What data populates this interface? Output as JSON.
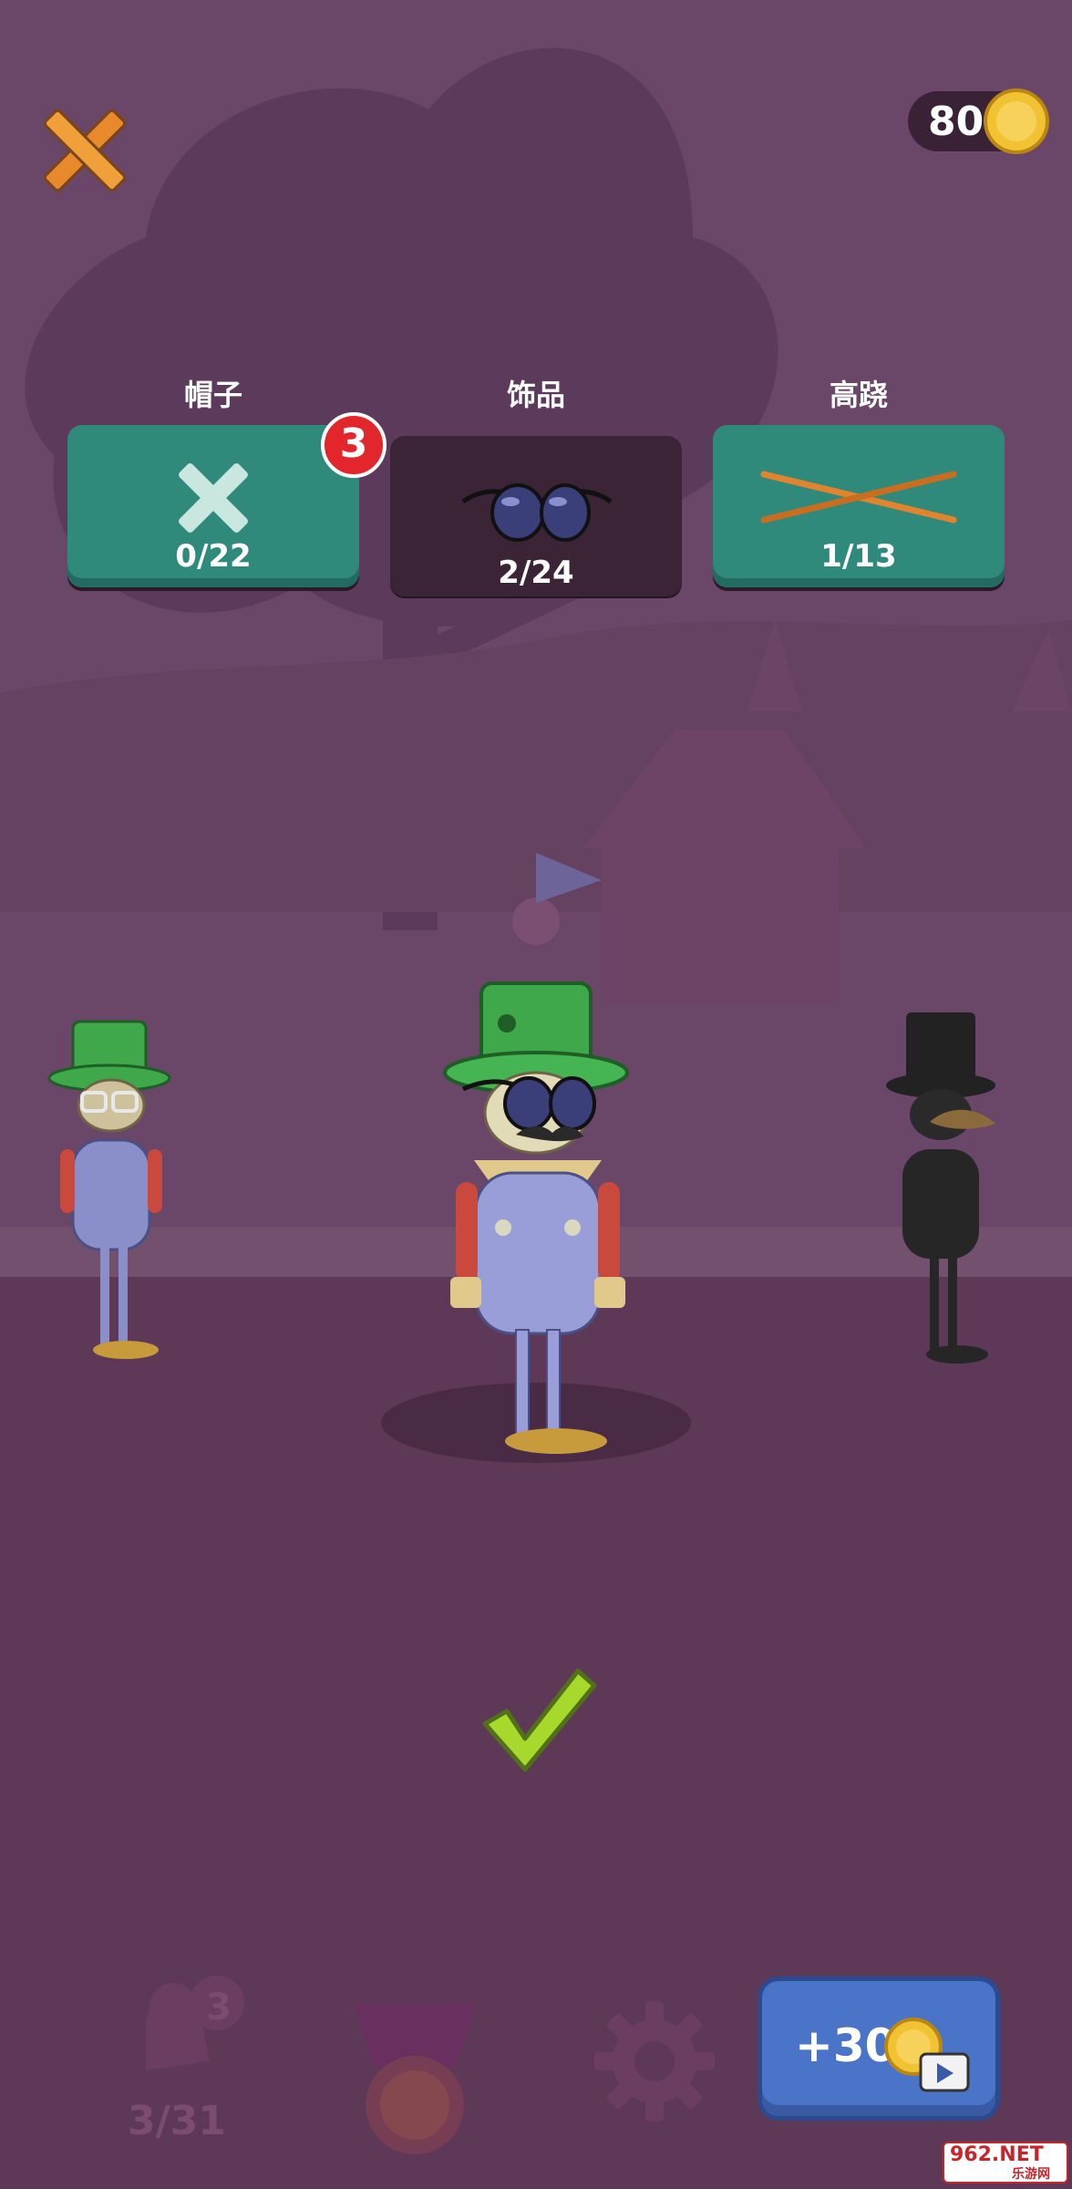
{
  "header": {
    "coins": "80"
  },
  "categories": [
    {
      "label": "帽子",
      "count": "0/22",
      "badge": "3",
      "icon": "x-none-icon"
    },
    {
      "label": "饰品",
      "count": "2/24",
      "icon": "sunglasses-icon"
    },
    {
      "label": "高跷",
      "count": "1/13",
      "icon": "stilts-icon"
    }
  ],
  "bottom_bar": {
    "characters_count": "3/31",
    "characters_badge": "3",
    "ad_reward": "+30"
  },
  "watermark": {
    "brand": "962.NET",
    "sub": "乐游网"
  },
  "colors": {
    "background": "#6a4668",
    "tab_green": "#2f8a7c",
    "tab_selected": "#3b2436",
    "badge_red": "#e3262b",
    "ad_button": "#4a74c8",
    "confirm_check": "#a6d92c"
  }
}
